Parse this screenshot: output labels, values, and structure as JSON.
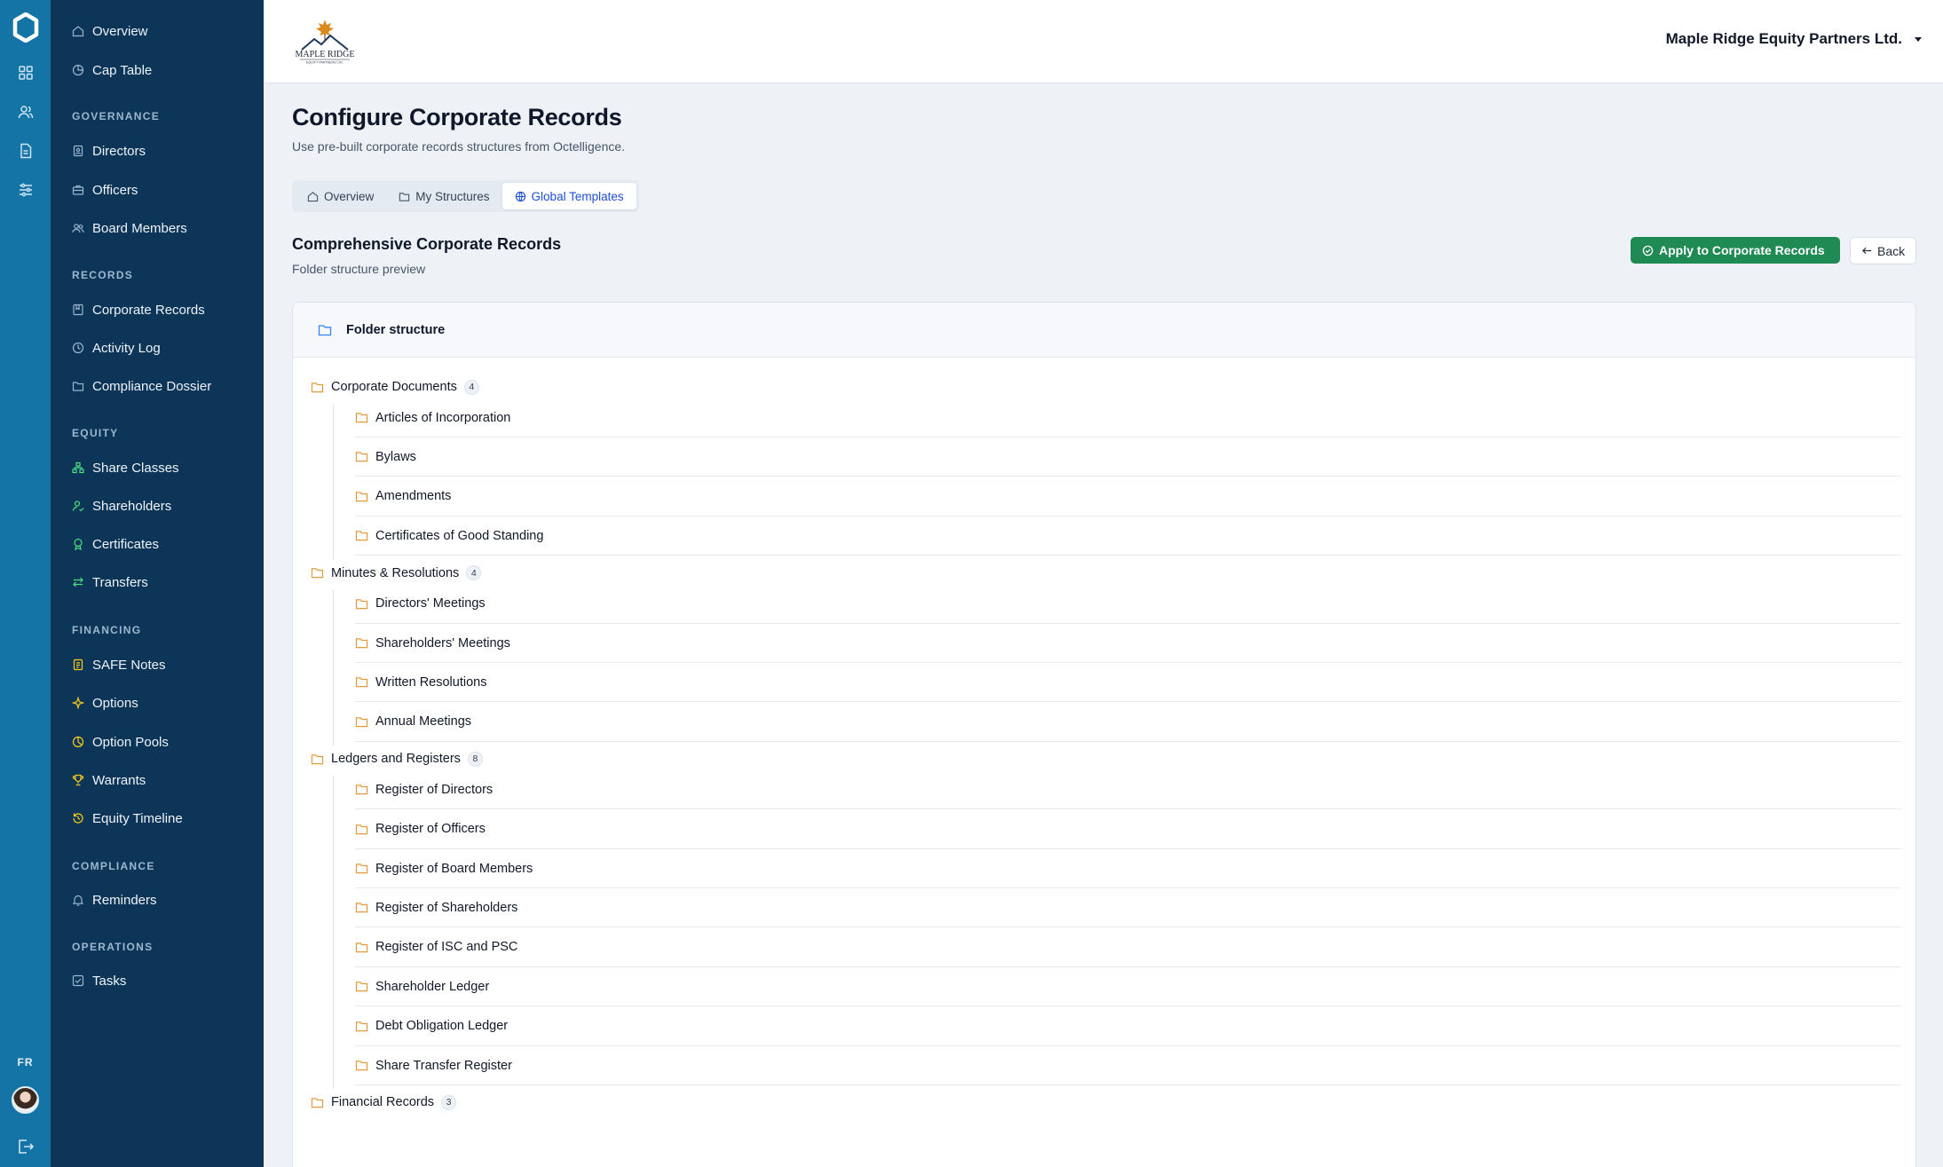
{
  "rail": {
    "items": [
      "grid-icon",
      "users-icon",
      "document-icon",
      "sliders-icon"
    ],
    "language": "FR"
  },
  "nav": {
    "top": [
      {
        "label": "Overview",
        "icon": "home-icon"
      },
      {
        "label": "Cap Table",
        "icon": "pie-chart-icon"
      }
    ],
    "sections": [
      {
        "title": "GOVERNANCE",
        "items": [
          {
            "label": "Directors",
            "icon": "badge-icon"
          },
          {
            "label": "Officers",
            "icon": "briefcase-icon"
          },
          {
            "label": "Board Members",
            "icon": "users-icon"
          }
        ]
      },
      {
        "title": "RECORDS",
        "items": [
          {
            "label": "Corporate Records",
            "icon": "book-icon"
          },
          {
            "label": "Activity Log",
            "icon": "clock-icon"
          },
          {
            "label": "Compliance Dossier",
            "icon": "folder-icon"
          }
        ]
      },
      {
        "title": "EQUITY",
        "items": [
          {
            "label": "Share Classes",
            "icon": "hierarchy-icon"
          },
          {
            "label": "Shareholders",
            "icon": "user-check-icon"
          },
          {
            "label": "Certificates",
            "icon": "award-icon"
          },
          {
            "label": "Transfers",
            "icon": "arrows-icon"
          }
        ]
      },
      {
        "title": "FINANCING",
        "items": [
          {
            "label": "SAFE Notes",
            "icon": "note-icon"
          },
          {
            "label": "Options",
            "icon": "sparkle-icon"
          },
          {
            "label": "Option Pools",
            "icon": "pie-chart-icon"
          },
          {
            "label": "Warrants",
            "icon": "trophy-icon"
          },
          {
            "label": "Equity Timeline",
            "icon": "history-icon"
          }
        ]
      },
      {
        "title": "COMPLIANCE",
        "items": [
          {
            "label": "Reminders",
            "icon": "bell-icon"
          }
        ]
      },
      {
        "title": "OPERATIONS",
        "items": [
          {
            "label": "Tasks",
            "icon": "checkbox-icon"
          }
        ]
      }
    ]
  },
  "topbar": {
    "logo_text": "MAPLE RIDGE",
    "logo_subtext": "EQUITY PARTNERS LTD.",
    "org_name": "Maple Ridge Equity Partners Ltd."
  },
  "page": {
    "title": "Configure Corporate Records",
    "subtitle": "Use pre-built corporate records structures from Octelligence.",
    "tabs": [
      {
        "label": "Overview",
        "icon": "home-icon",
        "active": false
      },
      {
        "label": "My Structures",
        "icon": "folder-icon",
        "active": false
      },
      {
        "label": "Global Templates",
        "icon": "globe-icon",
        "active": true
      }
    ],
    "template_title": "Comprehensive Corporate Records",
    "template_subtitle": "Folder structure preview",
    "apply_label": "Apply to Corporate Records",
    "back_label": "Back",
    "card_title": "Folder structure"
  },
  "folders": [
    {
      "name": "Corporate Documents",
      "count": "4",
      "children": [
        "Articles of Incorporation",
        "Bylaws",
        "Amendments",
        "Certificates of Good Standing"
      ]
    },
    {
      "name": "Minutes & Resolutions",
      "count": "4",
      "children": [
        "Directors' Meetings",
        "Shareholders' Meetings",
        "Written Resolutions",
        "Annual Meetings"
      ]
    },
    {
      "name": "Ledgers and Registers",
      "count": "8",
      "children": [
        "Register of Directors",
        "Register of Officers",
        "Register of Board Members",
        "Register of Shareholders",
        "Register of ISC and PSC",
        "Shareholder Ledger",
        "Debt Obligation Ledger",
        "Share Transfer Register"
      ]
    },
    {
      "name": "Financial Records",
      "count": "3",
      "children": []
    }
  ],
  "colors": {
    "rail": "#1474a6",
    "nav": "#0c3558",
    "accent": "#1d4ed8",
    "apply": "#1f8a54",
    "folder": "#e39a3b"
  }
}
